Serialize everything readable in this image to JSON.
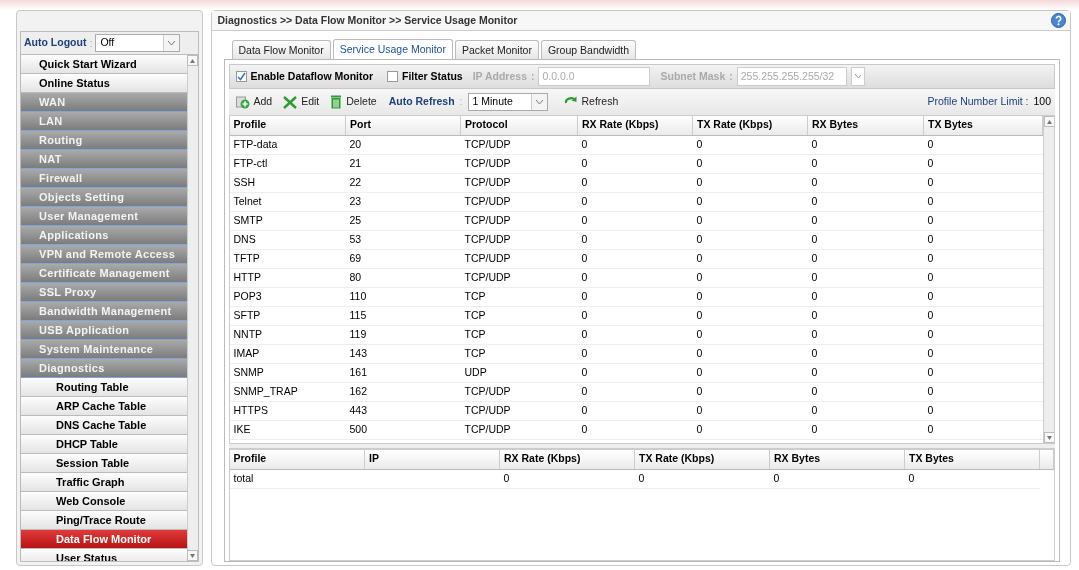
{
  "auto_logout": {
    "label": "Auto Logout",
    "separator": ":",
    "value": "Off"
  },
  "sidebar": {
    "items": [
      {
        "label": "Quick Start Wizard",
        "kind": "top",
        "selected": false
      },
      {
        "label": "Online Status",
        "kind": "top",
        "selected": false
      },
      {
        "label": "WAN",
        "kind": "section",
        "selected": false
      },
      {
        "label": "LAN",
        "kind": "section",
        "selected": false
      },
      {
        "label": "Routing",
        "kind": "section",
        "selected": false
      },
      {
        "label": "NAT",
        "kind": "section",
        "selected": false
      },
      {
        "label": "Firewall",
        "kind": "section",
        "selected": false
      },
      {
        "label": "Objects Setting",
        "kind": "section",
        "selected": false
      },
      {
        "label": "User Management",
        "kind": "section",
        "selected": false
      },
      {
        "label": "Applications",
        "kind": "section",
        "selected": false
      },
      {
        "label": "VPN and Remote Access",
        "kind": "section",
        "selected": false
      },
      {
        "label": "Certificate Management",
        "kind": "section",
        "selected": false
      },
      {
        "label": "SSL Proxy",
        "kind": "section",
        "selected": false
      },
      {
        "label": "Bandwidth Management",
        "kind": "section",
        "selected": false
      },
      {
        "label": "USB Application",
        "kind": "section",
        "selected": false
      },
      {
        "label": "System Maintenance",
        "kind": "section",
        "selected": false
      },
      {
        "label": "Diagnostics",
        "kind": "section",
        "selected": false
      },
      {
        "label": "Routing Table",
        "kind": "sub",
        "selected": false
      },
      {
        "label": "ARP Cache Table",
        "kind": "sub",
        "selected": false
      },
      {
        "label": "DNS Cache Table",
        "kind": "sub",
        "selected": false
      },
      {
        "label": "DHCP Table",
        "kind": "sub",
        "selected": false
      },
      {
        "label": "Session Table",
        "kind": "sub",
        "selected": false
      },
      {
        "label": "Traffic Graph",
        "kind": "sub",
        "selected": false
      },
      {
        "label": "Web Console",
        "kind": "sub",
        "selected": false
      },
      {
        "label": "Ping/Trace Route",
        "kind": "sub",
        "selected": false
      },
      {
        "label": "Data Flow Monitor",
        "kind": "sub",
        "selected": true
      },
      {
        "label": "User Status",
        "kind": "sub",
        "selected": false
      }
    ]
  },
  "breadcrumb": "Diagnostics >> Data Flow Monitor >> Service Usage Monitor",
  "tabs": [
    {
      "label": "Data Flow Monitor",
      "selected": false
    },
    {
      "label": "Service Usage Monitor",
      "selected": true
    },
    {
      "label": "Packet Monitor",
      "selected": false
    },
    {
      "label": "Group Bandwidth",
      "selected": false
    }
  ],
  "filter_bar": {
    "enable": {
      "label": "Enable Dataflow Monitor",
      "checked": true
    },
    "filter": {
      "label": "Filter Status",
      "checked": false
    },
    "ip_address": {
      "label": "IP Address",
      "separator": ":",
      "value": "0.0.0.0",
      "disabled": true
    },
    "subnet_mask": {
      "label": "Subnet Mask",
      "separator": ":",
      "value": "255.255.255.255/32",
      "disabled": true
    }
  },
  "toolbar": {
    "buttons": [
      {
        "label": "Add",
        "kind": "add"
      },
      {
        "label": "Edit",
        "kind": "edit"
      },
      {
        "label": "Delete",
        "kind": "delete"
      }
    ],
    "auto_refresh": {
      "label": "Auto Refresh",
      "separator": ":",
      "value": "1 Minute"
    },
    "refresh": "Refresh",
    "limit_label": "Profile Number Limit :",
    "limit_value": "100"
  },
  "table": {
    "columns": [
      "Profile",
      "Port",
      "Protocol",
      "RX Rate (Kbps)",
      "TX Rate (Kbps)",
      "RX Bytes",
      "TX Bytes"
    ],
    "rows": [
      [
        "FTP-data",
        "20",
        "TCP/UDP",
        "0",
        "0",
        "0",
        "0"
      ],
      [
        "FTP-ctl",
        "21",
        "TCP/UDP",
        "0",
        "0",
        "0",
        "0"
      ],
      [
        "SSH",
        "22",
        "TCP/UDP",
        "0",
        "0",
        "0",
        "0"
      ],
      [
        "Telnet",
        "23",
        "TCP/UDP",
        "0",
        "0",
        "0",
        "0"
      ],
      [
        "SMTP",
        "25",
        "TCP/UDP",
        "0",
        "0",
        "0",
        "0"
      ],
      [
        "DNS",
        "53",
        "TCP/UDP",
        "0",
        "0",
        "0",
        "0"
      ],
      [
        "TFTP",
        "69",
        "TCP/UDP",
        "0",
        "0",
        "0",
        "0"
      ],
      [
        "HTTP",
        "80",
        "TCP/UDP",
        "0",
        "0",
        "0",
        "0"
      ],
      [
        "POP3",
        "110",
        "TCP",
        "0",
        "0",
        "0",
        "0"
      ],
      [
        "SFTP",
        "115",
        "TCP",
        "0",
        "0",
        "0",
        "0"
      ],
      [
        "NNTP",
        "119",
        "TCP",
        "0",
        "0",
        "0",
        "0"
      ],
      [
        "IMAP",
        "143",
        "TCP",
        "0",
        "0",
        "0",
        "0"
      ],
      [
        "SNMP",
        "161",
        "UDP",
        "0",
        "0",
        "0",
        "0"
      ],
      [
        "SNMP_TRAP",
        "162",
        "TCP/UDP",
        "0",
        "0",
        "0",
        "0"
      ],
      [
        "HTTPS",
        "443",
        "TCP/UDP",
        "0",
        "0",
        "0",
        "0"
      ],
      [
        "IKE",
        "500",
        "TCP/UDP",
        "0",
        "0",
        "0",
        "0"
      ]
    ]
  },
  "summary_table": {
    "columns": [
      "Profile",
      "IP",
      "RX Rate (Kbps)",
      "TX Rate (Kbps)",
      "RX Bytes",
      "TX Bytes"
    ],
    "rows": [
      [
        "total",
        "",
        "0",
        "0",
        "0",
        "0"
      ]
    ]
  }
}
